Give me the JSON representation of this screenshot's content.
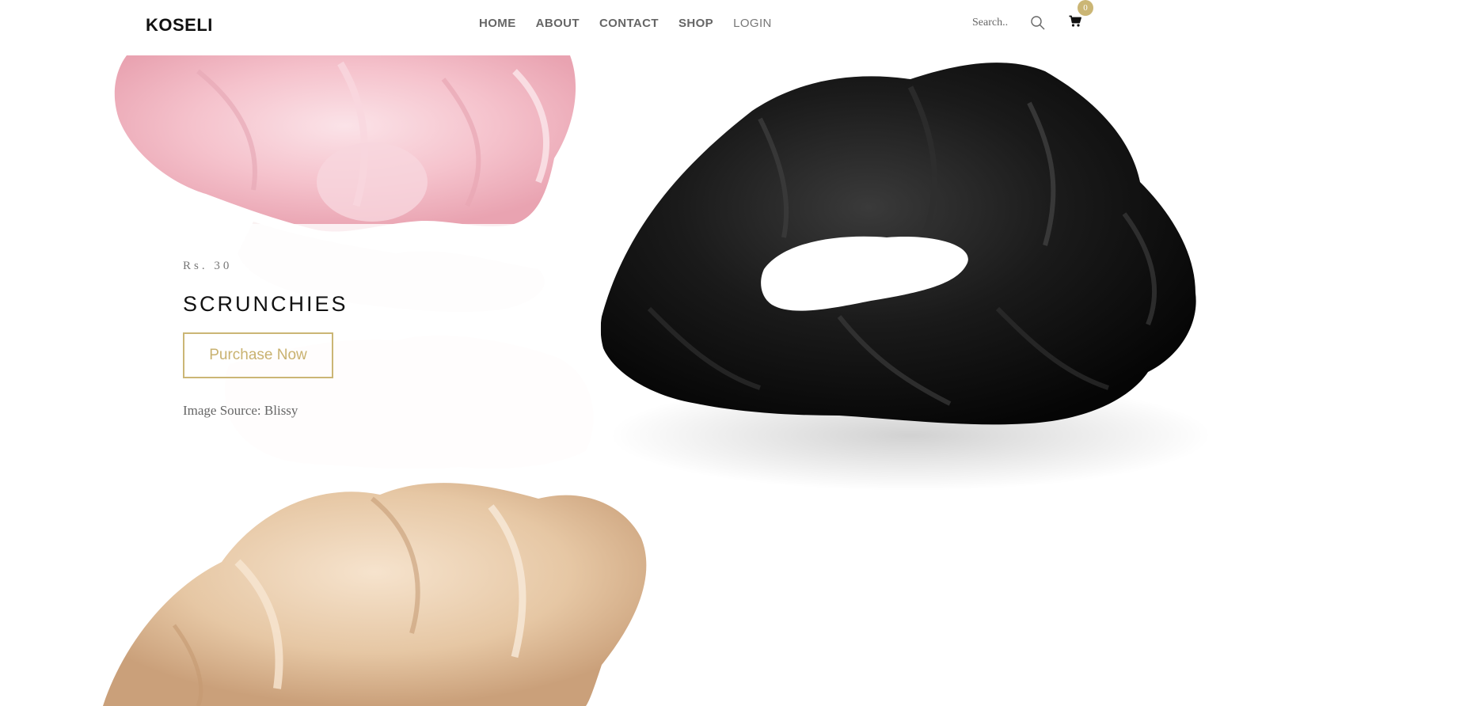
{
  "header": {
    "logo": "KOSELI",
    "nav": {
      "home": "HOME",
      "about": "ABOUT",
      "contact": "CONTACT",
      "shop": "SHOP",
      "login": "LOGIN"
    },
    "search": {
      "placeholder": "Search.."
    },
    "cart": {
      "count": "0"
    }
  },
  "hero": {
    "price": "Rs. 30",
    "title": "SCRUNCHIES",
    "button_label": "Purchase Now",
    "image_source": "Image Source: Blissy"
  },
  "colors": {
    "accent": "#cbb675",
    "text_dark": "#111111",
    "nav_text": "#666666"
  },
  "icons": [
    "search-icon",
    "cart-icon"
  ]
}
